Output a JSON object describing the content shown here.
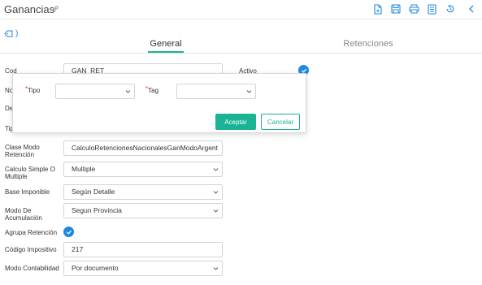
{
  "header": {
    "title": "Ganancias",
    "icons": [
      "link-icon",
      "new-document-icon",
      "save-icon",
      "print-icon",
      "list-icon",
      "history-icon",
      "back-icon"
    ]
  },
  "tag_toggle": {
    "label": ")"
  },
  "tabs": [
    {
      "label": "General",
      "active": true
    },
    {
      "label": "Retenciones",
      "active": false
    }
  ],
  "background_fields": {
    "codigo_label_part": "Cod",
    "codigo_value": "GAN_RET",
    "activo_label": "Activo",
    "nombre_label_part": "No",
    "descripcion_label_part": "De",
    "tipo_label_part": "Tip"
  },
  "form": {
    "clase_modo_retencion": {
      "label": "Clase Modo Retención",
      "value": "CalculoRetencionesNacionalesGanModoArgent"
    },
    "calculo_simple_o_multiple": {
      "label": "Calculo Simple O Multiple",
      "value": "Multiple"
    },
    "base_imponible": {
      "label": "Base Imponible",
      "value": "Según Detalle"
    },
    "modo_de_acumulacion": {
      "label": "Modo De Acumulación",
      "value": "Segun Provincia"
    },
    "agrupa_retencion": {
      "label": "Agrupa Retención",
      "checked": true
    },
    "codigo_impositivo": {
      "label": "Código Impositivo",
      "value": "217"
    },
    "modo_contabilidad": {
      "label": "Modo Contabilidad",
      "value": "Por documento"
    }
  },
  "popup": {
    "tipo_label": "Tipo",
    "tag_label": "Tag",
    "required_mark": "*",
    "tipo_value": "",
    "tag_value": "",
    "accept_label": "Aceptar",
    "cancel_label": "Cancelar"
  },
  "colors": {
    "accent": "#1ab394",
    "check_blue": "#1e88e5",
    "required": "#e53935",
    "toolbar_icon": "#1e88e5"
  }
}
